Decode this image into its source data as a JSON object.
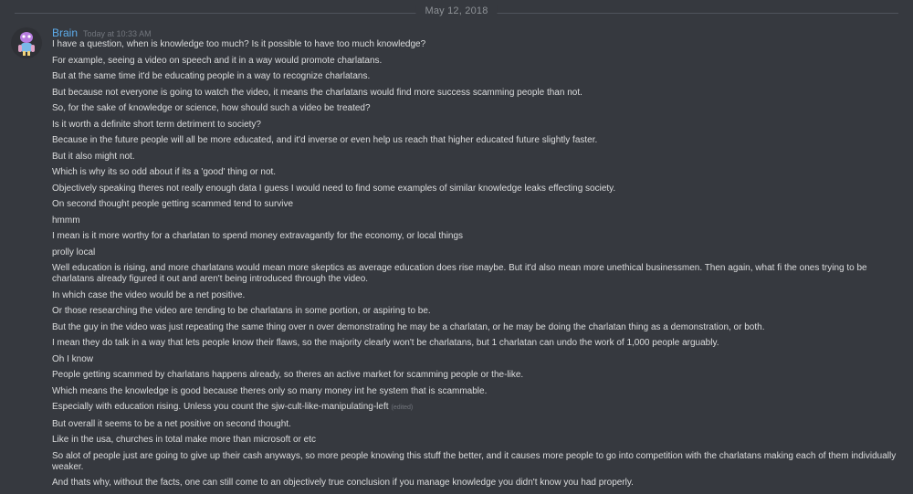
{
  "date_divider": "May 12, 2018",
  "author": {
    "name": "Brain",
    "timestamp": "Today at 10:33 AM",
    "colors": {
      "name": "#5dadec",
      "avatar_bg": "#3b4f7a"
    }
  },
  "messages": [
    "I have a question, when is knowledge too much? Is it possible to have too much knowledge?",
    "For example, seeing a video on speech and it in a way would promote charlatans.",
    "But at the same time it'd be educating people in a way to recognize charlatans.",
    "But because not everyone is going to watch the video, it means the charlatans would find more success scamming people than not.",
    "So, for the sake of knowledge or science, how should such a video be treated?",
    "Is it worth a definite short term detriment to society?",
    "Because in the future people will all be more educated, and it'd inverse or even help us reach that higher educated future slightly faster.",
    "But it also might not.",
    "Which is why its so odd about if its a 'good' thing or not.",
    "Objectively speaking theres not really enough data I guess I would need to find some examples of similar knowledge leaks effecting society.",
    "On second thought people getting scammed tend to survive",
    "hmmm",
    "I mean is it more worthy for a charlatan to spend money extravagantly for the economy, or local things",
    "prolly local",
    "Well education is rising, and more charlatans would mean more skeptics as average education does rise maybe. But it'd also mean more unethical businessmen. Then again, what fi the ones trying to be charlatans already figured it out and aren't being introduced through the video.",
    "In which case the video would be a net positive.",
    "Or those researching the video are tending to be charlatans in some portion, or aspiring to be.",
    "But the guy in the video was just repeating the same thing over n over demonstrating he may be a charlatan, or he may be doing the charlatan thing as a demonstration, or both.",
    "I mean they do talk in a way that lets people know their flaws, so the majority clearly won't be charlatans, but 1 charlatan can undo the work of 1,000 people arguably.",
    "Oh I know",
    "People getting scammed by charlatans happens already, so theres an active market for scamming people or the-like.",
    "Which means the knowledge is good because theres only so many money int he system that is scammable.",
    "Especially with education rising. Unless you count the sjw-cult-like-manipulating-left",
    "But overall it seems to be a net positive on second thought.",
    "Like in the usa, churches in total make more than microsoft or etc",
    "So alot of people just are going to give up their cash anyways, so more people knowing this stuff the better, and it causes more people to go into competition with the charlatans making each of them individually weaker.",
    "And thats why, without the facts, one can still come to an objectively true conclusion if you manage knowledge you didn't know you had properly."
  ],
  "edited_label": "(edited)"
}
